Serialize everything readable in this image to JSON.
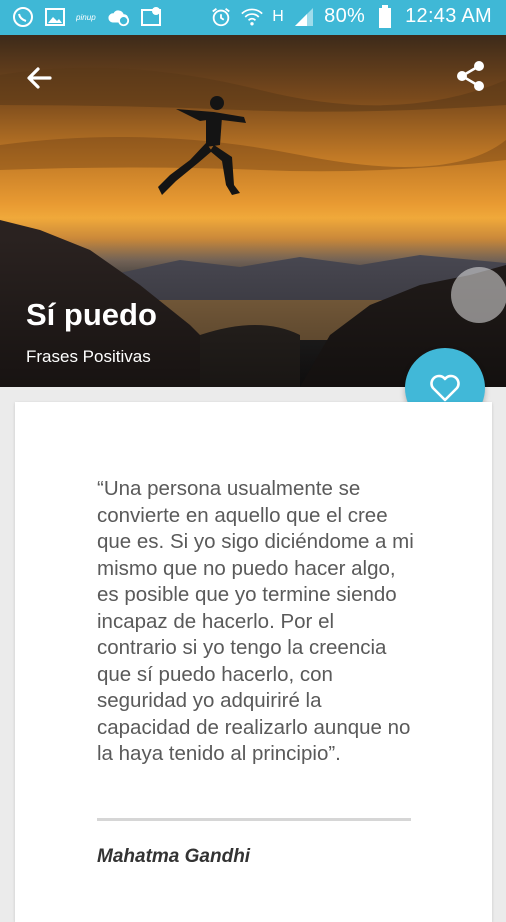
{
  "status_bar": {
    "battery": "80%",
    "time": "12:43 AM",
    "network": "H",
    "icons": [
      "phone-icon",
      "image-icon",
      "pinup-icon",
      "cloud-download-icon",
      "gallery-icon",
      "alarm-icon",
      "wifi-icon",
      "signal-icon",
      "battery-icon"
    ]
  },
  "header": {
    "title": "Sí puedo",
    "subtitle": "Frases Positivas",
    "back_icon": "arrow-back-icon",
    "share_icon": "share-icon",
    "fab_icon": "heart-outline-icon"
  },
  "quote": {
    "text": "“Una persona usualmente se convierte en aquello que el cree que es. Si yo sigo diciéndome a mi mismo que no puedo hacer algo, es posible que yo termine siendo incapaz de hacerlo. Por el contrario si yo tengo la creencia que sí puedo hacerlo, con seguridad yo adquiriré la capacidad de realizarlo aunque no la haya tenido al principio”.",
    "author": "Mahatma Gandhi"
  },
  "colors": {
    "accent": "#3fb8d6",
    "card": "#ffffff",
    "background": "#ebebeb"
  }
}
